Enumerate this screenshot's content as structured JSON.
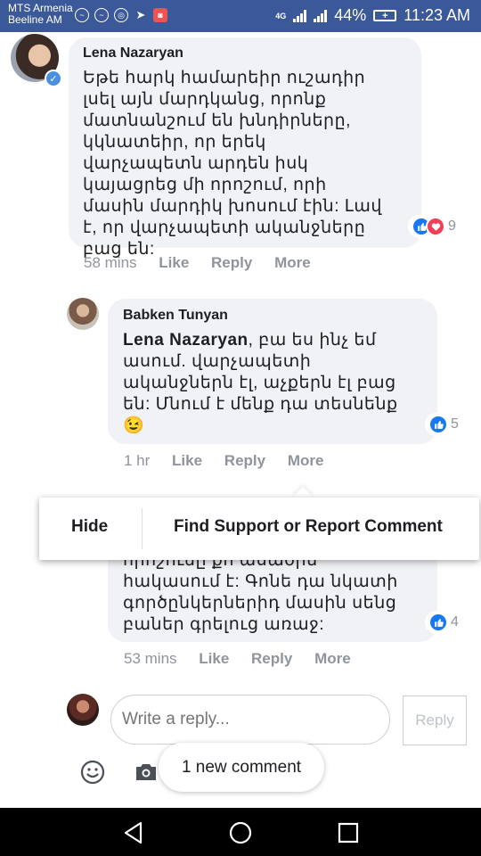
{
  "status_bar": {
    "carrier_1": "MTS Armenia",
    "carrier_2": "Beeline AM",
    "network": "4G",
    "battery": "44%",
    "time": "11:23 AM"
  },
  "comments": [
    {
      "author": "Lena Nazaryan",
      "text": "Եթե հարկ համարեիր ուշադիր լսել այն մարդկանց, որոնք մատնանշում են խնդիրները, կկնատեիր, որ երեկ վարչապետն արդեն իսկ կայացրեց մի որոշում, որի մասին մարդիկ խոսում էին: Լավ է, որ վարչապետի ականջները բաց են:",
      "reaction_count": "9",
      "time": "58 mins",
      "actions": [
        "Like",
        "Reply",
        "More"
      ],
      "verified": true
    },
    {
      "author": "Babken Tunyan",
      "mention": "Lena Nazaryan",
      "text": ", բա ես ինչ եմ ասում. վարչապետի ականջներն էլ, աչքերն էլ բաց են: Մնում է մենք դա տեսնենք",
      "emoji": "😉",
      "reaction_count": "5",
      "time": "1 hr",
      "actions": [
        "Like",
        "Reply",
        "More"
      ]
    },
    {
      "text": "որոշումը քո ասածին հակասում է: Գոնե դա նկատի գործընկերներիդ մասին սենց բաներ գրելուց առաջ:",
      "reaction_count": "4",
      "time": "53 mins",
      "actions": [
        "Like",
        "Reply",
        "More"
      ]
    }
  ],
  "context_menu": {
    "hide": "Hide",
    "report": "Find Support or Report Comment"
  },
  "reply_box": {
    "placeholder": "Write a reply...",
    "button": "Reply"
  },
  "new_comment_pill": "1 new comment",
  "colors": {
    "status_bar": "#3b5998",
    "like_blue": "#1877f2",
    "love_red": "#f33e58",
    "bubble": "#f0f2f5",
    "meta_gray": "#90949c"
  }
}
